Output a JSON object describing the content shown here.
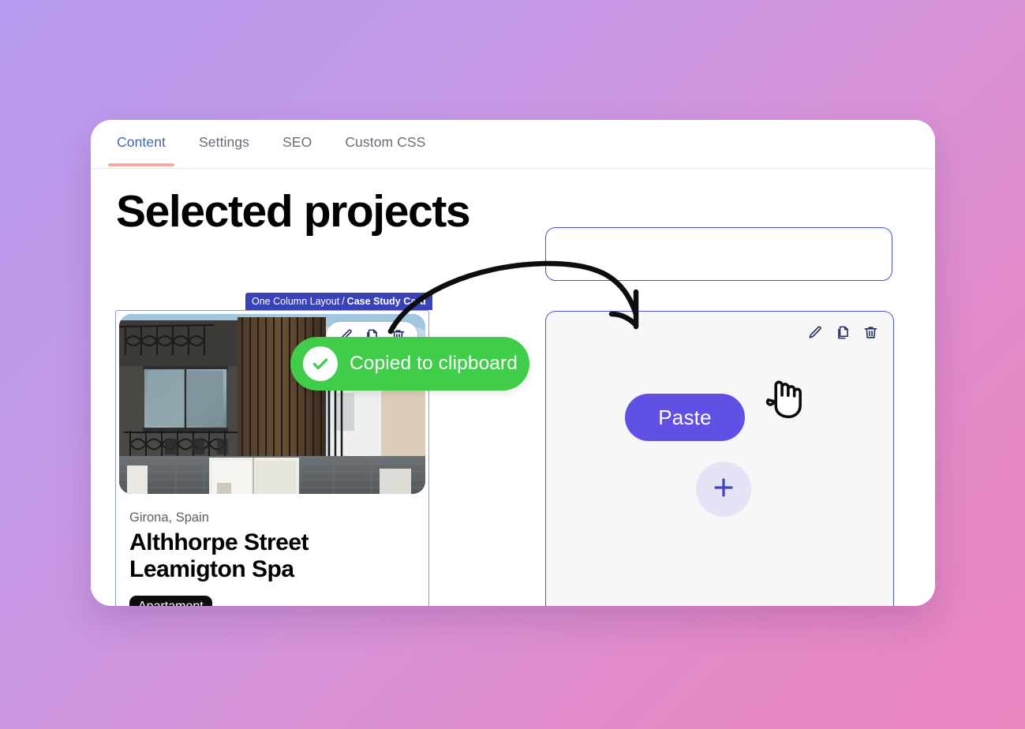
{
  "background": {
    "gradient_from": "#b79aee",
    "gradient_to": "#ea85c2"
  },
  "window": {
    "tabs": [
      {
        "label": "Content",
        "active": true
      },
      {
        "label": "Settings",
        "active": false
      },
      {
        "label": "SEO",
        "active": false
      },
      {
        "label": "Custom CSS",
        "active": false
      }
    ],
    "active_tab_underline_color": "#f3a9a1",
    "active_tab_text_color": "#3f6aa8"
  },
  "canvas": {
    "page_title": "Selected projects",
    "empty_field": {
      "value": "",
      "placeholder": "",
      "border_color": "#4a57c4"
    },
    "selected_card": {
      "badge": {
        "prefix": "One Column Layout",
        "separator": "/",
        "name": "Case Study Card",
        "background": "#3943b7"
      },
      "toolbar_icons": [
        "edit-pencil-icon",
        "duplicate-icon",
        "delete-trash-icon"
      ],
      "location": "Girona, Spain",
      "heading": "Althhorpe Street Leamigton Spa",
      "tag": "Apartament",
      "selection_border_color": "#8f9ad6"
    },
    "drop_panel": {
      "toolbar_icons": [
        "edit-pencil-icon",
        "duplicate-icon",
        "delete-trash-icon"
      ],
      "paste_label": "Paste",
      "paste_color": "#6150e4",
      "add_block_icon": "plus-icon",
      "add_block_bg": "#e5e3f6",
      "background": "#f7f7f8",
      "border_color": "#4a57c4"
    }
  },
  "toast": {
    "message": "Copied to clipboard",
    "icon": "check-circle-icon",
    "background": "#3fcd4a",
    "text_color": "#ffffff"
  },
  "annotations": {
    "arrow": "curved-drag-arrow",
    "cursor": "pointing-hand-cursor"
  }
}
